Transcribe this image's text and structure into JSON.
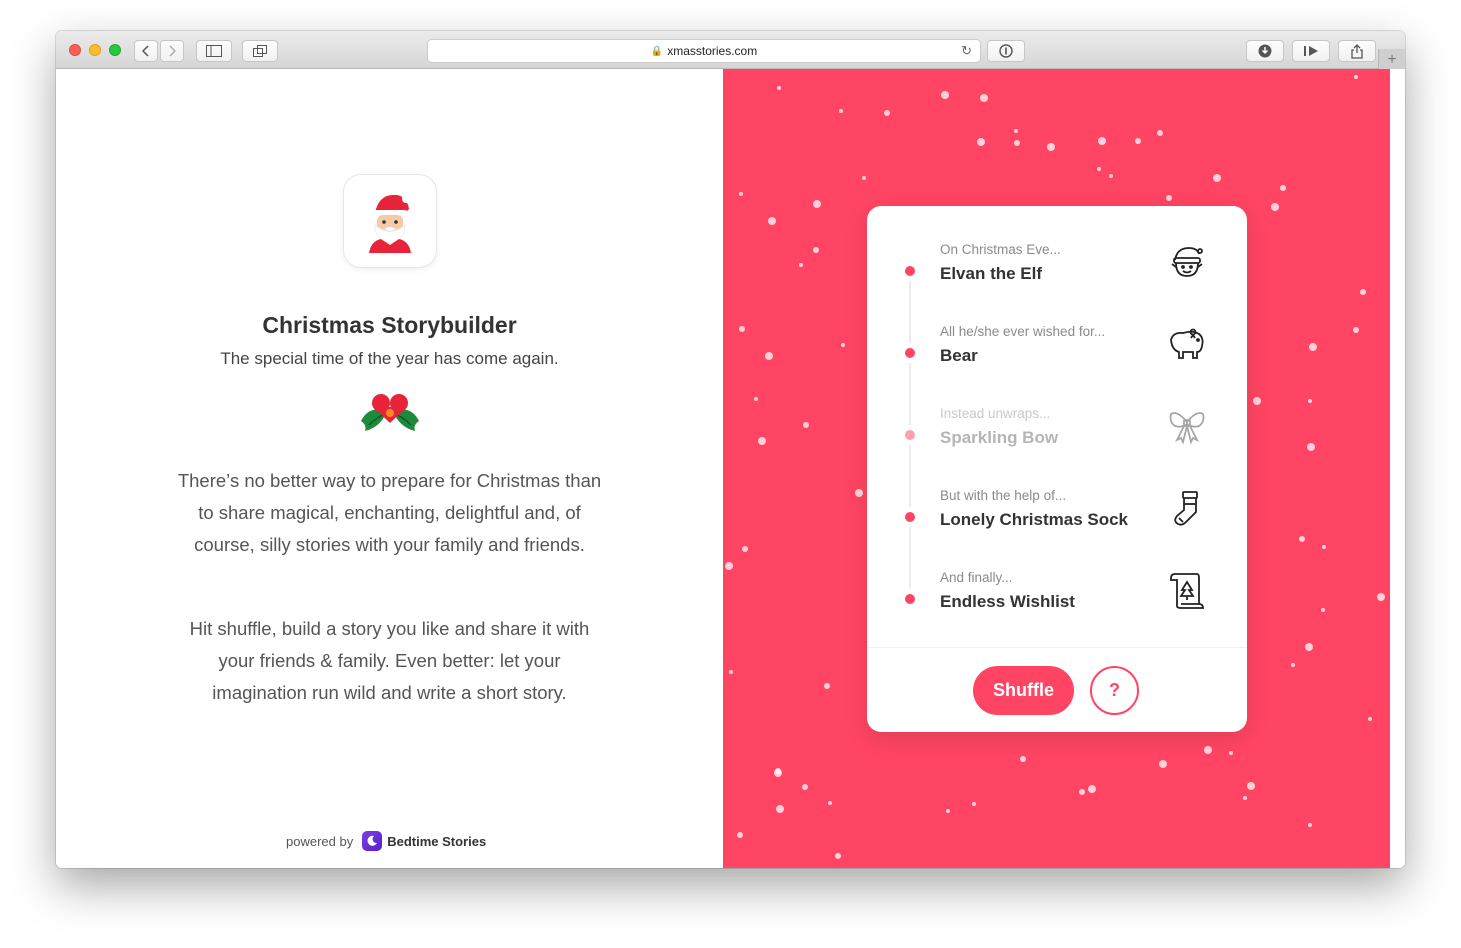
{
  "browser": {
    "url": "xmasstories.com"
  },
  "intro": {
    "title": "Christmas Storybuilder",
    "subtitle": "The special time of the year has come again.",
    "paragraph_1": "There’s no better way to prepare for Christmas than to share magical, enchanting, delightful and, of course, silly stories with your family and friends.",
    "paragraph_2": "Hit shuffle, build a story you like and share it with your friends & family. Even better: let your imagination run wild and write a short story.",
    "powered_by": "powered by",
    "brand": "Bedtime Stories"
  },
  "story": {
    "items": [
      {
        "label": "On Christmas Eve...",
        "value": "Elvan the Elf",
        "icon": "elf-icon",
        "faded": false
      },
      {
        "label": "All he/she ever wished for...",
        "value": "Bear",
        "icon": "bear-icon",
        "faded": false
      },
      {
        "label": "Instead unwraps...",
        "value": "Sparkling Bow",
        "icon": "bow-icon",
        "faded": true
      },
      {
        "label": "But with the help of...",
        "value": "Lonely Christmas Sock",
        "icon": "sock-icon",
        "faded": false
      },
      {
        "label": "And finally...",
        "value": "Endless Wishlist",
        "icon": "scroll-icon",
        "faded": false
      }
    ],
    "shuffle_label": "Shuffle",
    "help_label": "?"
  },
  "colors": {
    "accent": "#ff4563",
    "background_right": "#ff4563",
    "text_dark": "#333333"
  }
}
